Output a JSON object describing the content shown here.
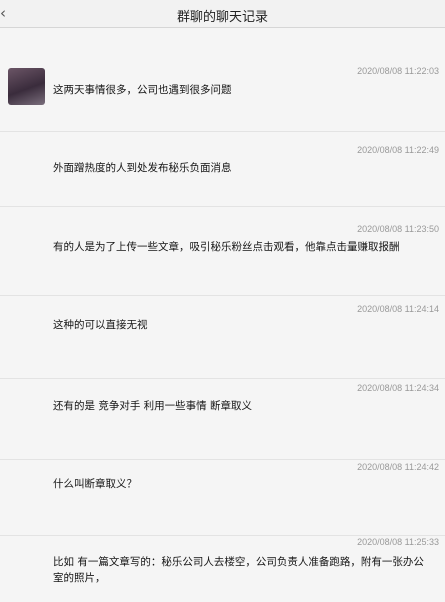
{
  "window": {
    "title": "群聊的聊天记录"
  },
  "messages": [
    {
      "sender": "",
      "time": "2020/08/08 11:22:03",
      "text": "这两天事情很多，公司也遇到很多问题"
    },
    {
      "sender": "",
      "time": "2020/08/08 11:22:49",
      "text": "外面蹭热度的人到处发布秘乐负面消息"
    },
    {
      "sender": "",
      "time": "2020/08/08 11:23:50",
      "text": "有的人是为了上传一些文章，吸引秘乐粉丝点击观看，他靠点击量赚取报酬"
    },
    {
      "sender": "",
      "time": "2020/08/08 11:24:14",
      "text": "这种的可以直接无视"
    },
    {
      "sender": "",
      "time": "2020/08/08 11:24:34",
      "text": "还有的是 竞争对手 利用一些事情 断章取义"
    },
    {
      "sender": "",
      "time": "2020/08/08 11:24:42",
      "text": "什么叫断章取义？"
    },
    {
      "sender": "",
      "time": "2020/08/08 11:25:33",
      "text": "比如 有一篇文章写的：秘乐公司人去楼空，公司负责人准备跑路，附有一张办公室的照片，"
    }
  ]
}
